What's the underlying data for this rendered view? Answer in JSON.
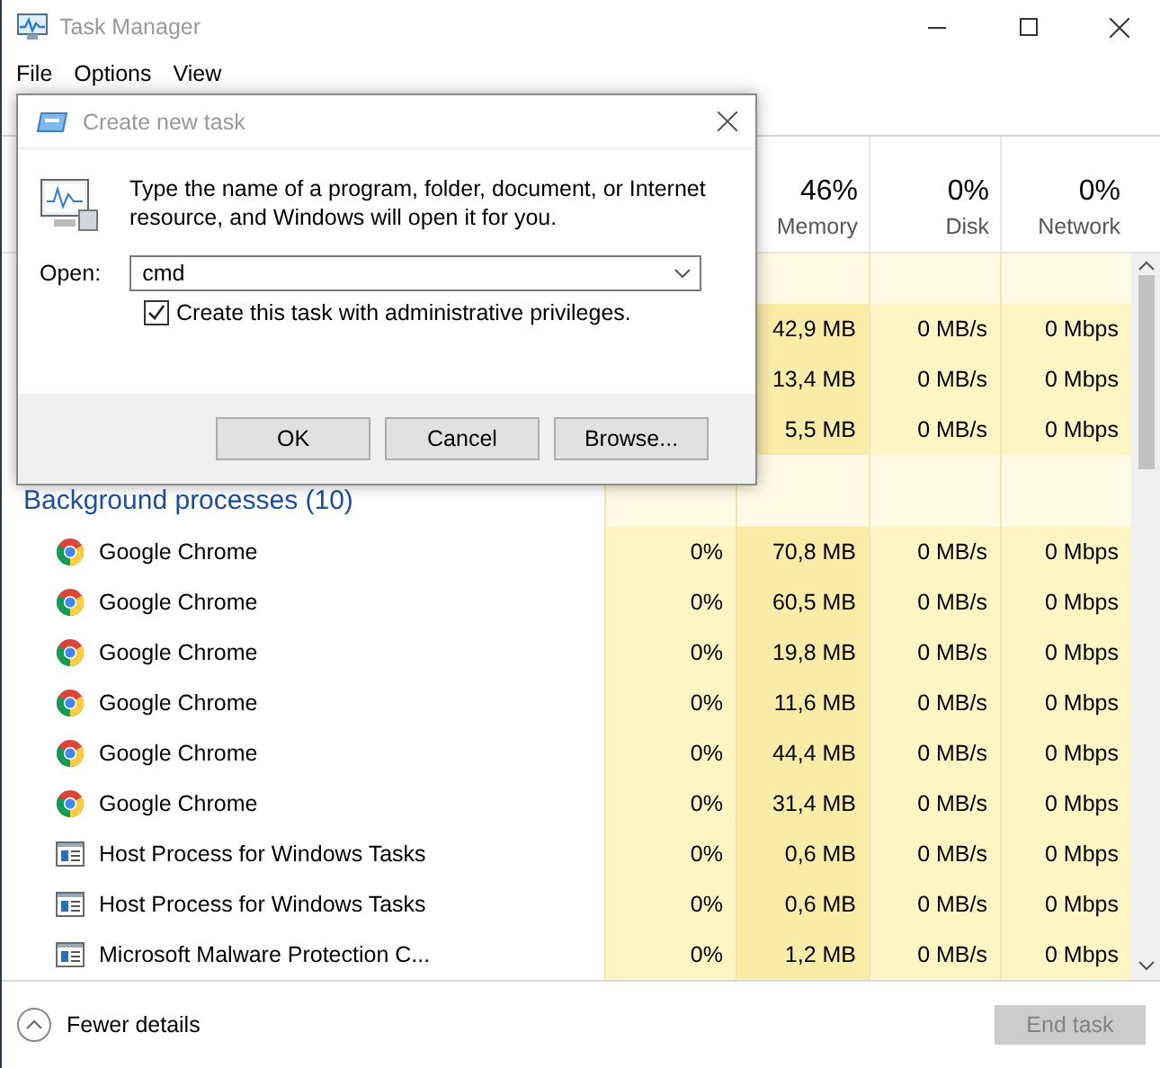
{
  "window": {
    "title": "Task Manager"
  },
  "menu": [
    "File",
    "Options",
    "View"
  ],
  "columns": [
    {
      "percent": "46%",
      "label": "Memory"
    },
    {
      "percent": "0%",
      "label": "Disk"
    },
    {
      "percent": "0%",
      "label": "Network"
    }
  ],
  "app_rows": [
    {
      "memory": "42,9 MB",
      "disk": "0 MB/s",
      "network": "0 Mbps"
    },
    {
      "memory": "13,4 MB",
      "disk": "0 MB/s",
      "network": "0 Mbps"
    },
    {
      "memory": "5,5 MB",
      "disk": "0 MB/s",
      "network": "0 Mbps"
    }
  ],
  "group": {
    "label": "Background processes (10)"
  },
  "processes": [
    {
      "kind": "chrome",
      "name": "Google Chrome",
      "cpu": "0%",
      "memory": "70,8 MB",
      "disk": "0 MB/s",
      "network": "0 Mbps"
    },
    {
      "kind": "chrome",
      "name": "Google Chrome",
      "cpu": "0%",
      "memory": "60,5 MB",
      "disk": "0 MB/s",
      "network": "0 Mbps"
    },
    {
      "kind": "chrome",
      "name": "Google Chrome",
      "cpu": "0%",
      "memory": "19,8 MB",
      "disk": "0 MB/s",
      "network": "0 Mbps"
    },
    {
      "kind": "chrome",
      "name": "Google Chrome",
      "cpu": "0%",
      "memory": "11,6 MB",
      "disk": "0 MB/s",
      "network": "0 Mbps"
    },
    {
      "kind": "chrome",
      "name": "Google Chrome",
      "cpu": "0%",
      "memory": "44,4 MB",
      "disk": "0 MB/s",
      "network": "0 Mbps"
    },
    {
      "kind": "chrome",
      "name": "Google Chrome",
      "cpu": "0%",
      "memory": "31,4 MB",
      "disk": "0 MB/s",
      "network": "0 Mbps"
    },
    {
      "kind": "service",
      "name": "Host Process for Windows Tasks",
      "cpu": "0%",
      "memory": "0,6 MB",
      "disk": "0 MB/s",
      "network": "0 Mbps"
    },
    {
      "kind": "service",
      "name": "Host Process for Windows Tasks",
      "cpu": "0%",
      "memory": "0,6 MB",
      "disk": "0 MB/s",
      "network": "0 Mbps"
    },
    {
      "kind": "service",
      "name": "Microsoft Malware Protection C...",
      "cpu": "0%",
      "memory": "1,2 MB",
      "disk": "0 MB/s",
      "network": "0 Mbps"
    }
  ],
  "footer": {
    "toggle": "Fewer details",
    "end_task": {
      "label": "End task",
      "disabled": true
    }
  },
  "dialog": {
    "title": "Create new task",
    "message": "Type the name of a program, folder, document, or Internet resource, and Windows will open it for you.",
    "open_label": "Open:",
    "open_value": "cmd",
    "admin_checkbox": {
      "label": "Create this task with administrative privileges.",
      "checked": true
    },
    "buttons": [
      "OK",
      "Cancel",
      "Browse..."
    ]
  }
}
